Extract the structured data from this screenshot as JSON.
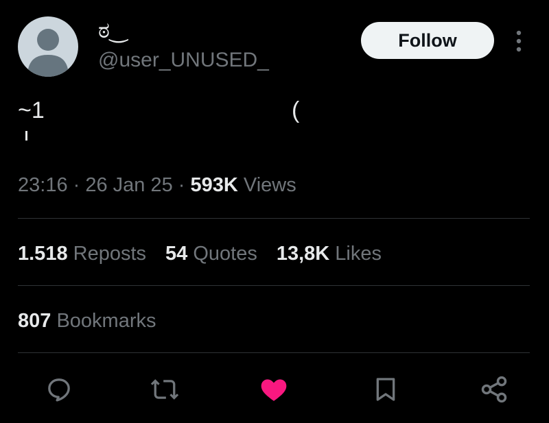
{
  "author": {
    "display_name": "ಠ‿",
    "handle": "@user_UNUSED_",
    "avatar_icon": "default-avatar-icon"
  },
  "follow_label": "Follow",
  "more_icon": "more-vertical-icon",
  "tweet": {
    "text_line1": "~1",
    "text_paren": "("
  },
  "meta": {
    "time": "23:16",
    "sep1": " · ",
    "date": "26 Jan 25",
    "sep2": " · ",
    "views_count": "593K",
    "views_label": " Views"
  },
  "stats": {
    "reposts": {
      "count": "1.518",
      "label": " Reposts"
    },
    "quotes": {
      "count": "54",
      "label": " Quotes"
    },
    "likes": {
      "count": "13,8K",
      "label": " Likes"
    },
    "bookmarks": {
      "count": "807",
      "label": " Bookmarks"
    }
  },
  "actions": [
    {
      "icon": "reply-icon",
      "color": "#71767b"
    },
    {
      "icon": "repost-icon",
      "color": "#71767b"
    },
    {
      "icon": "like-icon",
      "color": "#f91880",
      "active": true
    },
    {
      "icon": "bookmark-icon",
      "color": "#71767b"
    },
    {
      "icon": "share-icon",
      "color": "#71767b"
    }
  ],
  "colors": {
    "background": "#000000",
    "text_primary": "#e7e9ea",
    "text_secondary": "#71767b",
    "divider": "#2f3336",
    "like_active": "#f91880",
    "follow_bg": "#eff3f4"
  }
}
